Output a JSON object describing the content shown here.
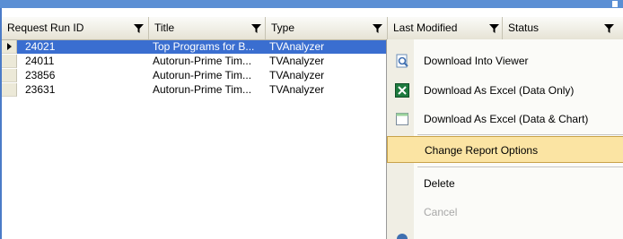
{
  "columns": [
    {
      "label": "Request Run ID"
    },
    {
      "label": "Title"
    },
    {
      "label": "Type"
    },
    {
      "label": "Last Modified"
    },
    {
      "label": "Status"
    }
  ],
  "rows": [
    {
      "id": "24021",
      "title": "Top Programs for B...",
      "type": "TVAnalyzer",
      "selected": true
    },
    {
      "id": "24011",
      "title": "Autorun-Prime Tim...",
      "type": "TVAnalyzer",
      "selected": false
    },
    {
      "id": "23856",
      "title": "Autorun-Prime Tim...",
      "type": "TVAnalyzer",
      "selected": false
    },
    {
      "id": "23631",
      "title": "Autorun-Prime Tim...",
      "type": "TVAnalyzer",
      "selected": false
    }
  ],
  "context_menu": {
    "items": [
      {
        "label": "Download Into Viewer",
        "icon": "viewer-icon"
      },
      {
        "label": "Download As Excel (Data Only)",
        "icon": "excel-icon"
      },
      {
        "label": "Download As Excel (Data & Chart)",
        "icon": "chart-icon"
      },
      {
        "label": "Change Report Options",
        "icon": "",
        "highlighted": true
      },
      {
        "label": "Delete",
        "icon": ""
      },
      {
        "label": "Cancel",
        "icon": "",
        "disabled": true
      }
    ]
  },
  "colors": {
    "selection": "#3a6ed0",
    "menu_highlight": "#fbe4a3",
    "titlebar": "#5b8fd4"
  }
}
